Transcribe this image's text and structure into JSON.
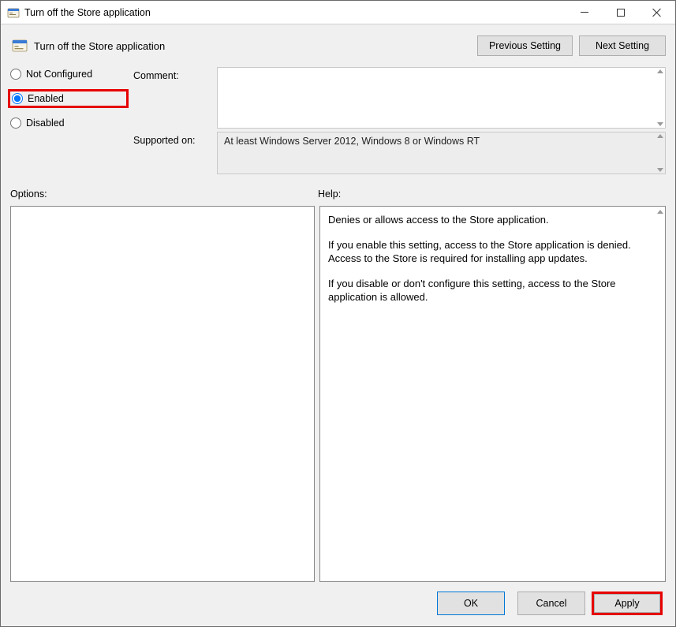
{
  "window": {
    "title": "Turn off the Store application"
  },
  "header": {
    "policy_name": "Turn off the Store application",
    "prev_label": "Previous Setting",
    "next_label": "Next Setting"
  },
  "settings": {
    "radio_not_configured": "Not Configured",
    "radio_enabled": "Enabled",
    "radio_disabled": "Disabled",
    "selected": "enabled",
    "comment_label": "Comment:",
    "comment_value": "",
    "supported_label": "Supported on:",
    "supported_value": "At least Windows Server 2012, Windows 8 or Windows RT"
  },
  "lower": {
    "options_label": "Options:",
    "help_label": "Help:",
    "help_p1": "Denies or allows access to the Store application.",
    "help_p2": "If you enable this setting, access to the Store application is denied. Access to the Store is required for installing app updates.",
    "help_p3": "If you disable or don't configure this setting, access to the Store application is allowed."
  },
  "buttons": {
    "ok": "OK",
    "cancel": "Cancel",
    "apply": "Apply"
  }
}
